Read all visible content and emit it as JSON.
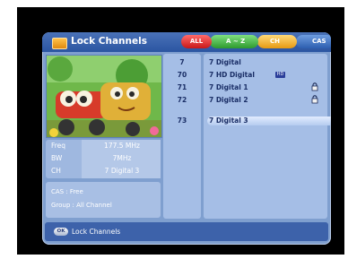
{
  "header": {
    "title": "Lock Channels",
    "buttons": [
      {
        "label": "ALL",
        "color": "#d92a2a"
      },
      {
        "label": "A ~ Z",
        "color": "#3faf3f"
      },
      {
        "label": "CH",
        "color": "#f2b22c"
      },
      {
        "label": "CAS",
        "color": "#3c6fc0"
      }
    ]
  },
  "info": {
    "freq_label": "Freq",
    "freq_value": "177.5 MHz",
    "bw_label": "BW",
    "bw_value": "7MHz",
    "ch_label": "CH",
    "ch_value": "7 Digital 3",
    "cas_text": "CAS : Free",
    "group_text": "Group : All Channel"
  },
  "channels": [
    {
      "number": "7",
      "name": "7 Digital",
      "hd": false,
      "locked": false
    },
    {
      "number": "70",
      "name": "7 HD Digital",
      "hd": true,
      "hd_label": "HD",
      "locked": false
    },
    {
      "number": "71",
      "name": "7 Digital 1",
      "hd": false,
      "locked": true
    },
    {
      "number": "72",
      "name": "7 Digital 2",
      "hd": false,
      "locked": true
    },
    {
      "number": "73",
      "name": "7 Digital 3",
      "hd": false,
      "locked": false,
      "selected": true
    }
  ],
  "footer": {
    "ok_label": "OK",
    "action_label": "Lock Channels"
  }
}
